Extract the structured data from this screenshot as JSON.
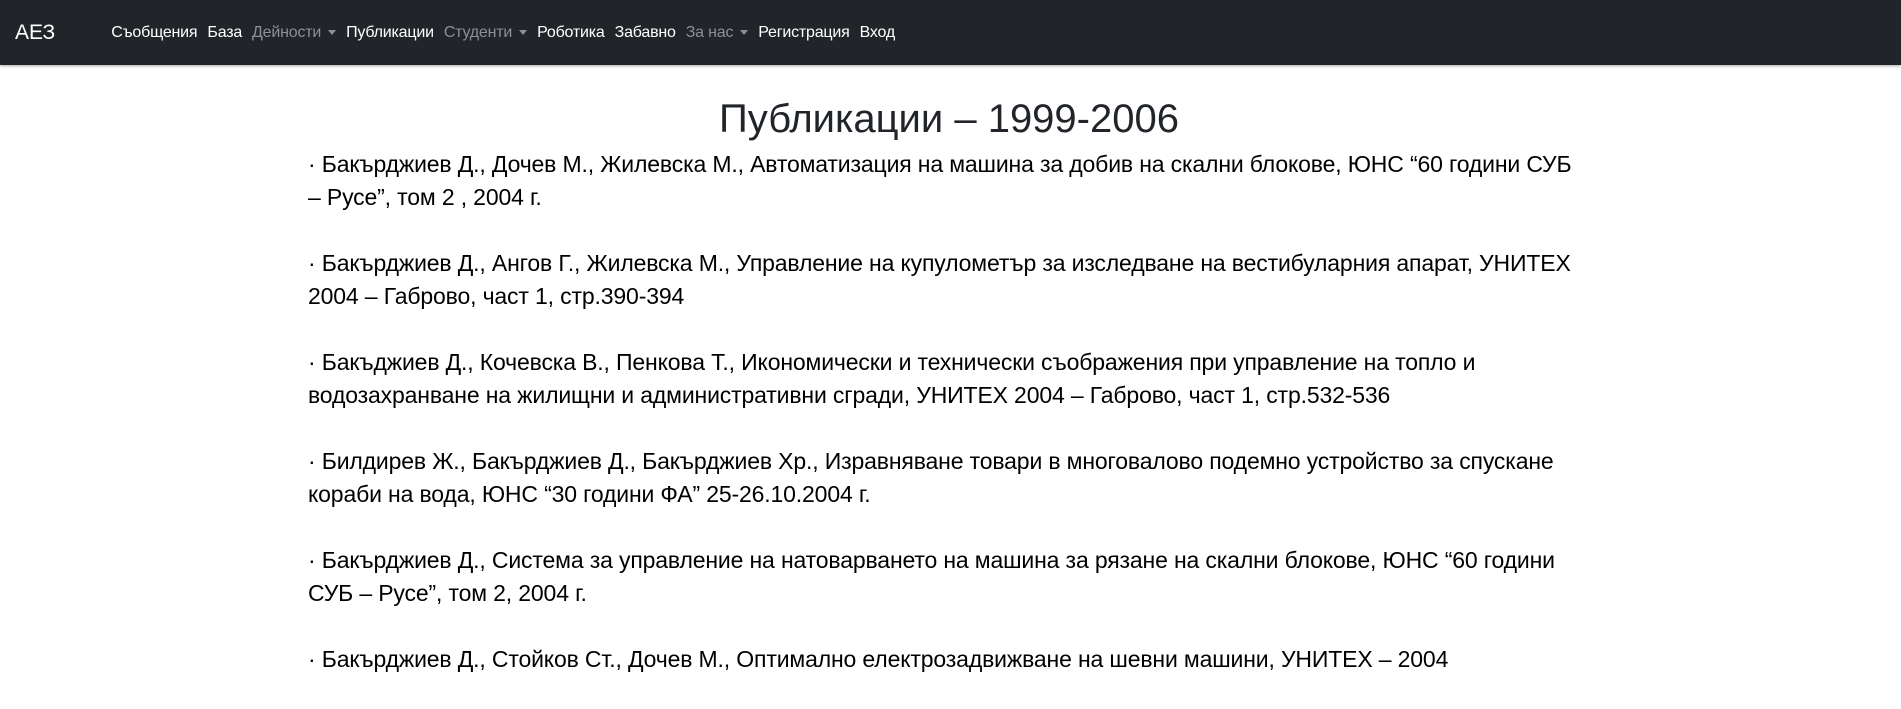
{
  "navbar": {
    "brand": "АЕЗ",
    "items": [
      {
        "label": "Съобщения",
        "style": "active",
        "dropdown": false
      },
      {
        "label": "База",
        "style": "active",
        "dropdown": false
      },
      {
        "label": "Дейности",
        "style": "muted",
        "dropdown": true
      },
      {
        "label": "Публикации",
        "style": "active",
        "dropdown": false
      },
      {
        "label": "Студенти",
        "style": "muted",
        "dropdown": true
      },
      {
        "label": "Роботика",
        "style": "active",
        "dropdown": false
      },
      {
        "label": "Забавно",
        "style": "active",
        "dropdown": false
      },
      {
        "label": "За нас",
        "style": "muted",
        "dropdown": true
      },
      {
        "label": "Регистрация",
        "style": "active",
        "dropdown": false
      },
      {
        "label": "Вход",
        "style": "active",
        "dropdown": false
      }
    ]
  },
  "main": {
    "title": "Публикации – 1999-2006",
    "publications": [
      "· Бакърджиев Д., Дочев М., Жилевска М., Автоматизация на машина за добив на скални блокове, ЮНС “60 години СУБ – Русе”, том 2 , 2004 г.",
      "· Бакърджиев Д., Ангов Г., Жилевска М., Управление на купулометър за изследване на вестибуларния апарат, УНИТЕХ 2004 – Габрово, част 1, стр.390-394",
      "· Бакъджиев Д., Кочевска В., Пенкова Т., Икономически и технически съображения при управление на топло и водозахранване на жилищни и административни сгради, УНИТЕХ 2004 – Габрово, част 1, стр.532-536",
      "· Билдирев Ж., Бакърджиев Д., Бакърджиев Хр., Изравняване товари в многовалово подемно устройство за спускане кораби на вода, ЮНС “30 години ФА” 25-26.10.2004 г.",
      "· Бакърджиев Д., Система за управление на натоварването на машина за рязане на скални блокове, ЮНС “60 години СУБ – Русе”, том 2, 2004 г.",
      "· Бакърджиев Д., Стойков Ст., Дочев М., Оптимално електрозадвижване на шевни машини, УНИТЕХ – 2004"
    ]
  },
  "colors": {
    "navbar_bg": "#212529",
    "nav_active": "#ffffff",
    "nav_muted": "#8b9096",
    "text": "#000000"
  }
}
